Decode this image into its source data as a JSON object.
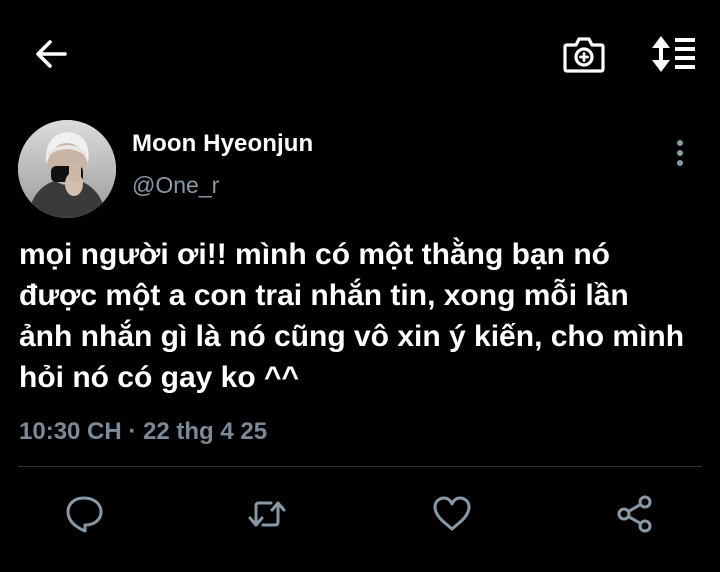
{
  "header": {
    "back_icon": "arrow-left-icon",
    "camera_icon": "camera-add-icon",
    "sort_icon": "sort-list-icon"
  },
  "author": {
    "name": "Moon Hyeonjun",
    "handle": "@One_r",
    "avatar": "avatar-photo"
  },
  "tweet": {
    "text": "mọi người ơi!! mình có một thằng bạn nó\nđược một a con trai nhắn tin, xong mỗi lần\nảnh nhắn gì là nó cũng vô xin ý kiến, cho mình\nhỏi nó có gay ko ^^",
    "timestamp": "10:30 CH · 22 thg 4 25"
  },
  "actions": [
    {
      "icon": "reply-icon"
    },
    {
      "icon": "retweet-icon"
    },
    {
      "icon": "like-heart-icon"
    },
    {
      "icon": "share-icon"
    }
  ],
  "colors": {
    "background": "#000000",
    "text": "#ffffff",
    "muted": "#8a98a6",
    "icon": "#8899a6",
    "divider": "#2f3336"
  }
}
